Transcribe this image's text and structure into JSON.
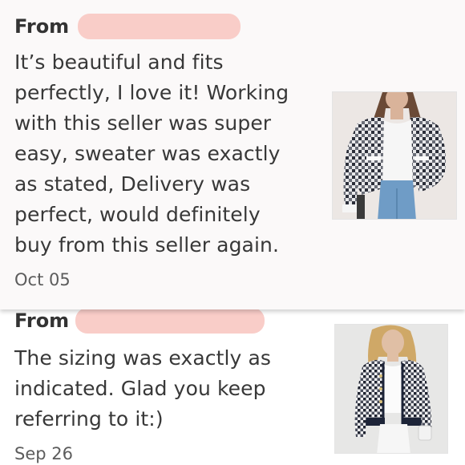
{
  "reviews": [
    {
      "from_label": "From",
      "lines": [
        "It’s beautiful and fits",
        "perfectly, I love it! Working",
        "with this seller was super",
        "easy, sweater was exactly",
        "as stated, Delivery was",
        "perfect, would definitely",
        "buy from this seller again."
      ],
      "date": "Oct 05"
    },
    {
      "from_label": "From",
      "lines": [
        "The sizing was exactly as",
        "indicated. Glad you keep",
        "referring to it:)"
      ],
      "date": "Sep 26"
    }
  ],
  "colors": {
    "redaction": "#f9cdc8",
    "card_background": "#fbf9f9",
    "text": "#383838"
  }
}
